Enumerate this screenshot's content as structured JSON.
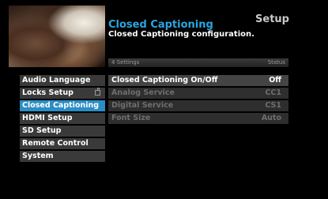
{
  "header": {
    "title": "Closed Captioning",
    "subtitle": "Closed Captioning configuration.",
    "section": "Setup"
  },
  "info_bar": {
    "count": "4 Settings",
    "status_label": "Status"
  },
  "menu": {
    "items": [
      {
        "label": "Audio Language"
      },
      {
        "label": "Locks Setup"
      },
      {
        "label": "Closed Captioning"
      },
      {
        "label": "HDMI Setup"
      },
      {
        "label": "SD Setup"
      },
      {
        "label": "Remote Control"
      },
      {
        "label": "System"
      }
    ],
    "selected": "Closed Captioning"
  },
  "settings": [
    {
      "name": "Closed Captioning On/Off",
      "value": "Off",
      "enabled": true
    },
    {
      "name": "Analog Service",
      "value": "CC1",
      "enabled": false
    },
    {
      "name": "Digital Service",
      "value": "CS1",
      "enabled": false
    },
    {
      "name": "Font Size",
      "value": "Auto",
      "enabled": false
    }
  ],
  "colors": {
    "accent": "#2b8ec4",
    "title": "#2aa6de"
  }
}
